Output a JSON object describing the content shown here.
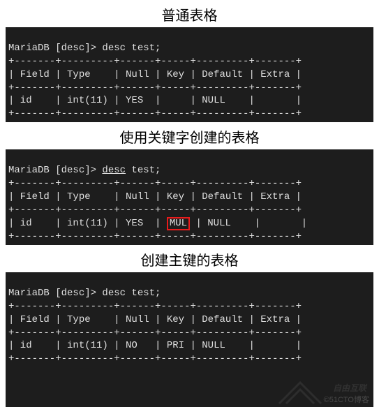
{
  "sections": [
    {
      "caption": "普通表格",
      "prompt_prefix": "MariaDB [desc]> ",
      "command": "desc test;",
      "cmd_underline": false,
      "border": "+-------+---------+------+-----+---------+-------+",
      "header": "| Field | Type    | Null | Key | Default | Extra |",
      "row_pre": "| id    | int(11) | YES  | ",
      "key_cell": "   ",
      "highlight_key": false,
      "row_post": " | NULL    |       |"
    },
    {
      "caption": "使用关键字创建的表格",
      "prompt_prefix": "MariaDB [desc]> ",
      "command": "desc",
      "command_rest": " test;",
      "cmd_underline": true,
      "border": "+-------+---------+------+-----+---------+-------+",
      "header": "| Field | Type    | Null | Key | Default | Extra |",
      "row_pre": "| id    | int(11) | YES  | ",
      "key_cell": "MUL",
      "highlight_key": true,
      "row_post": " | NULL    |       |"
    },
    {
      "caption": "创建主键的表格",
      "prompt_prefix": "MariaDB [desc]> ",
      "command": "desc test;",
      "cmd_underline": false,
      "border": "+-------+---------+------+-----+---------+-------+",
      "header": "| Field | Type    | Null | Key | Default | Extra |",
      "row_pre": "| id    | int(11) | NO   | ",
      "key_cell": "PRI",
      "highlight_key": false,
      "row_post": " | NULL    |       |"
    }
  ],
  "chart_data": {
    "type": "table",
    "tables": [
      {
        "title": "普通表格",
        "columns": [
          "Field",
          "Type",
          "Null",
          "Key",
          "Default",
          "Extra"
        ],
        "rows": [
          [
            "id",
            "int(11)",
            "YES",
            "",
            "NULL",
            ""
          ]
        ]
      },
      {
        "title": "使用关键字创建的表格",
        "columns": [
          "Field",
          "Type",
          "Null",
          "Key",
          "Default",
          "Extra"
        ],
        "rows": [
          [
            "id",
            "int(11)",
            "YES",
            "MUL",
            "NULL",
            ""
          ]
        ]
      },
      {
        "title": "创建主键的表格",
        "columns": [
          "Field",
          "Type",
          "Null",
          "Key",
          "Default",
          "Extra"
        ],
        "rows": [
          [
            "id",
            "int(11)",
            "NO",
            "PRI",
            "NULL",
            ""
          ]
        ]
      }
    ]
  },
  "watermark": {
    "brand": "自由互联",
    "source": "©51CTO博客"
  }
}
